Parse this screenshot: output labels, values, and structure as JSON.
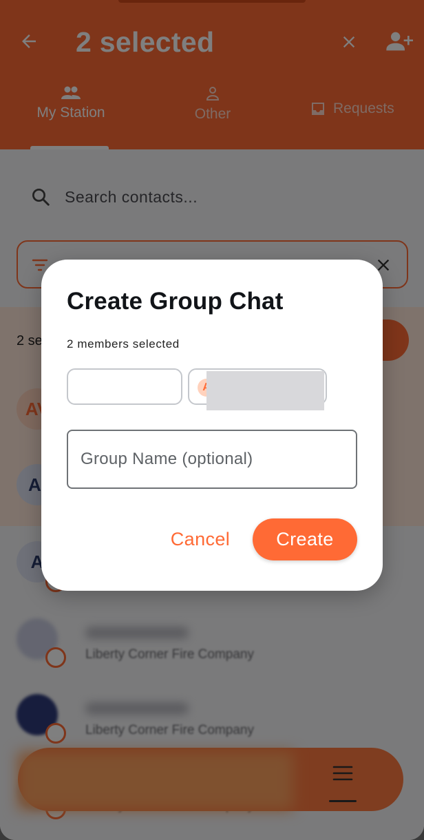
{
  "header": {
    "title": "2 selected",
    "tabs": [
      {
        "label": "My Station",
        "icon": "group-icon"
      },
      {
        "label": "Other",
        "icon": "person-icon"
      },
      {
        "label": "Requests",
        "icon": "inbox-icon"
      }
    ],
    "accent": "#ff6a35"
  },
  "search": {
    "placeholder": "Search contacts..."
  },
  "selection": {
    "count_text": "2 se"
  },
  "contacts": [
    {
      "initials": "AV"
    },
    {
      "initials": "Al"
    },
    {
      "initials": "A"
    },
    {
      "org": "Liberty Corner Fire Company"
    },
    {
      "org": "Liberty Corner Fire Company"
    },
    {
      "org": "Liberty Corner Fire Company"
    }
  ],
  "dialog": {
    "title": "Create Group Chat",
    "subtitle": "2 members selected",
    "chip_initial": "A",
    "group_name_placeholder": "Group Name (optional)",
    "cancel_label": "Cancel",
    "create_label": "Create"
  }
}
